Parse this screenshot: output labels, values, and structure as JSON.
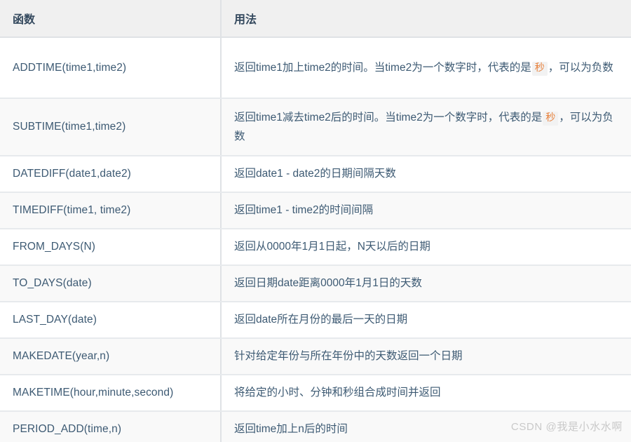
{
  "table": {
    "columns": [
      {
        "key": "function",
        "label": "函数"
      },
      {
        "key": "usage",
        "label": "用法"
      }
    ],
    "rows": [
      {
        "function": "ADDTIME(time1,time2)",
        "usage_pre": "返回time1加上time2的时间。当time2为一个数字时，代表的是",
        "usage_tag": "秒",
        "usage_post": "，可以为负数"
      },
      {
        "function": "SUBTIME(time1,time2)",
        "usage_pre": "返回time1减去time2后的时间。当time2为一个数字时，代表的是",
        "usage_tag": "秒",
        "usage_post": "，可以为负数"
      },
      {
        "function": "DATEDIFF(date1,date2)",
        "usage": "返回date1 - date2的日期间隔天数"
      },
      {
        "function": "TIMEDIFF(time1, time2)",
        "usage": "返回time1 - time2的时间间隔"
      },
      {
        "function": "FROM_DAYS(N)",
        "usage": "返回从0000年1月1日起，N天以后的日期"
      },
      {
        "function": "TO_DAYS(date)",
        "usage": "返回日期date距离0000年1月1日的天数"
      },
      {
        "function": "LAST_DAY(date)",
        "usage": "返回date所在月份的最后一天的日期"
      },
      {
        "function": "MAKEDATE(year,n)",
        "usage": "针对给定年份与所在年份中的天数返回一个日期"
      },
      {
        "function": "MAKETIME(hour,minute,second)",
        "usage": "将给定的小时、分钟和秒组合成时间并返回"
      },
      {
        "function": "PERIOD_ADD(time,n)",
        "usage": "返回time加上n后的时间"
      }
    ]
  },
  "watermark": {
    "text": "CSDN @我是小水水啊"
  },
  "colors": {
    "header_bg": "#f0f0f0",
    "header_text": "#34495e",
    "body_text": "#3d5a73",
    "alt_row_bg": "#f9f9f9",
    "row_bg": "#ffffff",
    "border": "#dfe2e5",
    "code_tag_text": "#e8803a",
    "code_tag_bg": "#f2f2f2",
    "watermark_text": "#c9c9c9"
  }
}
